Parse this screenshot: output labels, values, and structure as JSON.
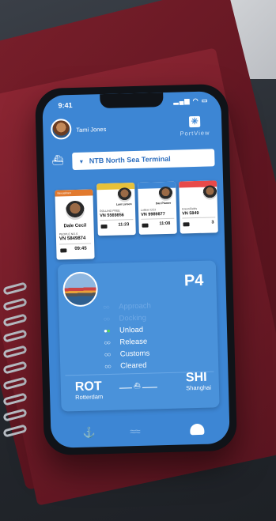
{
  "status_bar": {
    "time": "9:41",
    "icons": "▂▄▆ ◠ ▭"
  },
  "header": {
    "user_name": "Tami Jones",
    "brand": "PortView",
    "logo_glyph": "✳"
  },
  "terminal": {
    "selected": "NTB North Sea Terminal",
    "caret": "▼",
    "icon": "⛴"
  },
  "cards": [
    {
      "company": "Nexuslinen",
      "name": "Dale Cecil",
      "label": "PEOPLE NO.S",
      "vn": "VN 5849874",
      "time": "09:45",
      "color": "#e27a2e"
    },
    {
      "company": "",
      "name": "Lani Larson",
      "label": "ROLLING FREE",
      "vn": "VN 5569856",
      "time": "11:23",
      "color": "#e7c13a"
    },
    {
      "company": "",
      "name": "Dan Plumer",
      "label": "Lolliver CC3",
      "vn": "VN 9989877",
      "time": "11:08",
      "color": "#3d86d4"
    },
    {
      "company": "",
      "name": "",
      "label": "GreenFields",
      "vn": "VN 5849",
      "time": "3",
      "color": "#e84a4a"
    }
  ],
  "detail": {
    "berth": "P4",
    "steps": [
      {
        "label": "Approach",
        "state": "pending"
      },
      {
        "label": "Docking",
        "state": "pending"
      },
      {
        "label": "Unload",
        "state": "active"
      },
      {
        "label": "Release",
        "state": "future"
      },
      {
        "label": "Customs",
        "state": "future"
      },
      {
        "label": "Cleared",
        "state": "future"
      }
    ],
    "origin": {
      "code": "ROT",
      "city": "Rotterdam"
    },
    "destination": {
      "code": "SHI",
      "city": "Shanghai"
    },
    "route_glyph": "⛴"
  },
  "tabs": [
    {
      "name": "anchor-icon",
      "glyph": "⚓"
    },
    {
      "name": "waves-icon",
      "glyph": "≈≈"
    },
    {
      "name": "captain-icon",
      "glyph": "▬"
    }
  ]
}
